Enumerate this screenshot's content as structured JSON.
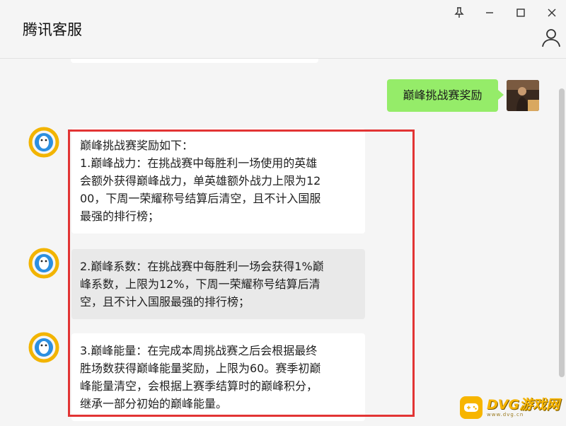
{
  "window": {
    "title": "腾讯客服"
  },
  "messages": {
    "sent": "巅峰挑战赛奖励",
    "received": [
      "巅峰挑战赛奖励如下：\n1.巅峰战力：在挑战赛中每胜利一场使用的英雄\n会额外获得巅峰战力，单英雄额外战力上限为12\n00，下周一荣耀称号结算后清空，且不计入国服\n最强的排行榜；",
      "2.巅峰系数：在挑战赛中每胜利一场会获得1%巅\n峰系数，上限为12%，下周一荣耀称号结算后清\n空，且不计入国服最强的排行榜；",
      "3.巅峰能量：在完成本周挑战赛之后会根据最终\n胜场数获得巅峰能量奖励，上限为60。赛季初巅\n峰能量清空，会根据上赛季结算时的巅峰积分，\n继承一部分初始的巅峰能量。"
    ]
  },
  "icons": {
    "pin": "pin-icon",
    "minimize": "minimize-icon",
    "maximize": "maximize-icon",
    "close": "close-icon",
    "user": "user-icon",
    "bot_avatar": "tencent-qq-penguin-icon"
  },
  "colors": {
    "sent_bubble": "#95ec69",
    "highlight": "#e23434",
    "watermark": "#f7b500"
  },
  "watermark": {
    "brand": "DVG游戏网",
    "url": "www.dvg.cn"
  }
}
